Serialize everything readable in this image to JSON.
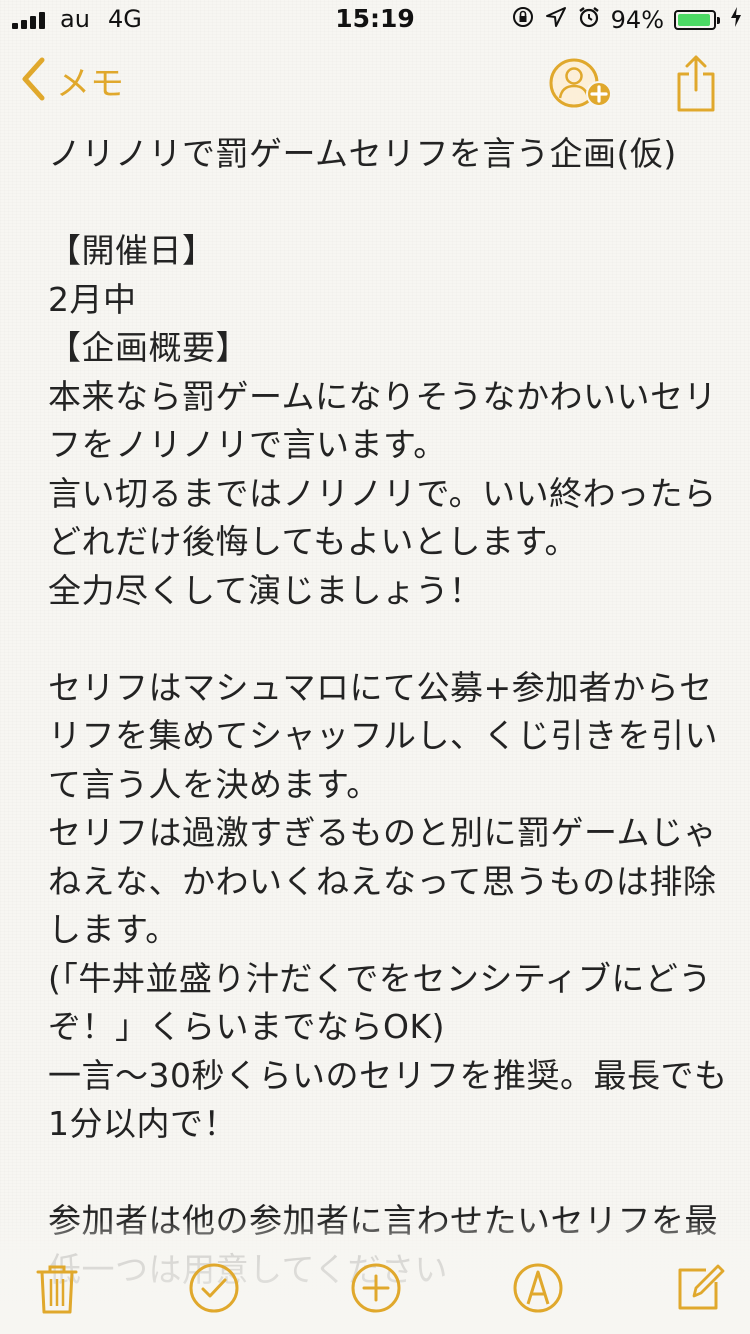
{
  "status_bar": {
    "carrier": "au",
    "network": "4G",
    "time": "15:19",
    "battery_percent": "94%",
    "battery_level": 0.94,
    "icons": [
      "signal-icon",
      "orientation-lock-icon",
      "location-icon",
      "alarm-icon",
      "battery-icon",
      "charging-icon"
    ]
  },
  "nav": {
    "back_label": "メモ",
    "accent_color": "#e0a82c"
  },
  "note": {
    "lines": [
      "ノリノリで罰ゲームセリフを言う企画(仮)",
      "",
      "【開催日】",
      "2月中",
      "【企画概要】",
      "本来なら罰ゲームになりそうなかわいいセリ",
      "フをノリノリで言います。",
      "言い切るまではノリノリで。いい終わったら",
      "どれだけ後悔してもよいとします。",
      "全力尽くして演じましょう！",
      "",
      "セリフはマシュマロにて公募+参加者からセ",
      "リフを集めてシャッフルし、くじ引きを引い",
      "て言う人を決めます。",
      "セリフは過激すぎるものと別に罰ゲームじゃ",
      "ねえな、かわいくねえなって思うものは排除",
      "します。",
      "(「牛丼並盛り汁だくでをセンシティブにどう",
      "ぞ！」くらいまでならOK)",
      "一言〜30秒くらいのセリフを推奨。最長でも",
      "1分以内で！",
      "",
      "参加者は他の参加者に言わせたいセリフを最",
      "低一つは用意してください"
    ]
  },
  "toolbar": {
    "items": [
      "trash-icon",
      "checklist-icon",
      "add-icon",
      "sketch-icon",
      "compose-icon"
    ]
  }
}
